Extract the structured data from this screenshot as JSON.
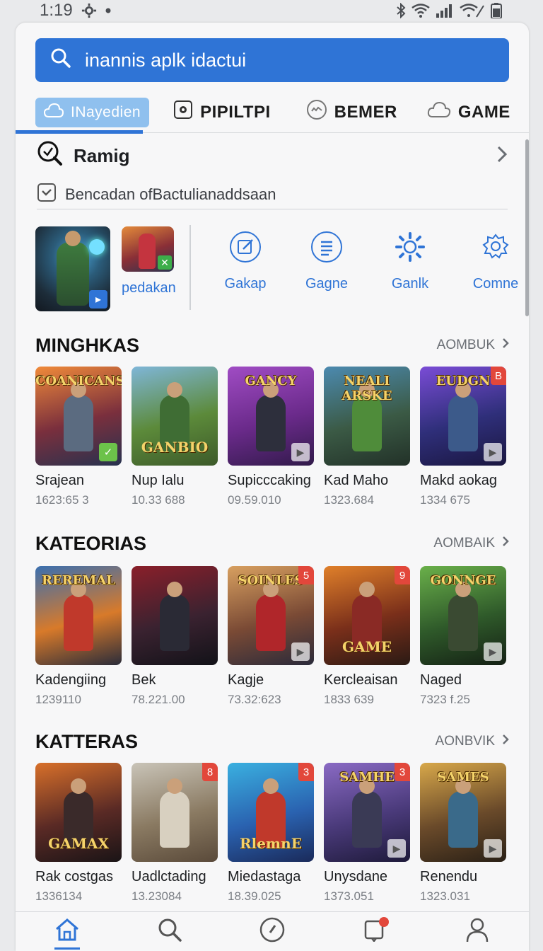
{
  "status_bar": {
    "time": "1:19"
  },
  "search": {
    "placeholder": "inannis aplk idactui"
  },
  "tabs": [
    {
      "label": "INayedien",
      "icon": "cloud-icon",
      "active": true
    },
    {
      "label": "PIPILTPI",
      "icon": "gear-box-icon"
    },
    {
      "label": "BEMER",
      "icon": "gamepad-icon"
    },
    {
      "label": "GAME",
      "icon": "cloud-outline-icon"
    }
  ],
  "ranking": {
    "title": "Ramig",
    "info_text": "Bencadan ofBactulianaddsaan"
  },
  "featured": {
    "small_label": "pedakan"
  },
  "shortcuts": [
    {
      "label": "Gakap",
      "icon": "edit-icon"
    },
    {
      "label": "Gagne",
      "icon": "list-icon"
    },
    {
      "label": "Ganlk",
      "icon": "settings-icon"
    },
    {
      "label": "Comne",
      "icon": "cog-icon"
    }
  ],
  "sections": [
    {
      "title": "MINGHKAS",
      "more": "AOMBUK",
      "items": [
        {
          "name": "Srajean",
          "meta": "1623:65 3",
          "thumb_title": "COANICANS",
          "thumb_bottom": "",
          "colors": [
            "#f08a3a",
            "#7a2f3d",
            "#27324f"
          ],
          "hero": "#5b6b80",
          "badge": "check"
        },
        {
          "name": "Nup Ialu",
          "meta": "10.33 688",
          "thumb_title": "",
          "thumb_bottom": "GANBIO",
          "colors": [
            "#7fb6d8",
            "#5c8a3a",
            "#3d5a2a"
          ],
          "hero": "#3f6d34",
          "badge": ""
        },
        {
          "name": "Supicccaking",
          "meta": "09.59.010",
          "thumb_title": "GANCY",
          "thumb_bottom": "",
          "colors": [
            "#a04cc4",
            "#6a2a8a",
            "#311a4a"
          ],
          "hero": "#2d2f3c",
          "badge": "play"
        },
        {
          "name": "Kad Maho",
          "meta": "1323.684",
          "thumb_title": "NEALI ARSKE",
          "thumb_bottom": "",
          "colors": [
            "#4c8ab0",
            "#3b5a45",
            "#223128"
          ],
          "hero": "#4f8c3a",
          "badge": ""
        },
        {
          "name": "Makd aokag",
          "meta": "1334 675",
          "thumb_title": "EUDGN",
          "thumb_bottom": "",
          "colors": [
            "#7a4cd6",
            "#2f2f7a",
            "#1a1640"
          ],
          "hero": "#3c5a8a",
          "badge": "play",
          "num": "B"
        }
      ]
    },
    {
      "title": "KATEORIAS",
      "more": "AOMBAIK",
      "items": [
        {
          "name": "Kadengiing",
          "meta": "1239110",
          "thumb_title": "REREMAL",
          "thumb_bottom": "",
          "colors": [
            "#3a6fb0",
            "#d87a2a",
            "#2a2c3a"
          ],
          "hero": "#c0392b",
          "badge": ""
        },
        {
          "name": "Bek",
          "meta": "78.221.00",
          "thumb_title": "",
          "thumb_bottom": "",
          "colors": [
            "#8a1f2a",
            "#3a2230",
            "#121218"
          ],
          "hero": "#2a2a35",
          "badge": ""
        },
        {
          "name": "Kagje",
          "meta": "73.32:623",
          "thumb_title": "SOINLES",
          "thumb_bottom": "",
          "colors": [
            "#d8a060",
            "#7a4a35",
            "#2a2a3a"
          ],
          "hero": "#b0262a",
          "badge": "play",
          "num": "5"
        },
        {
          "name": "Kercleaisan",
          "meta": "1833 639",
          "thumb_title": "",
          "thumb_bottom": "GAME",
          "colors": [
            "#e0802a",
            "#7a2f1a",
            "#2a1a14"
          ],
          "hero": "#8a2a25",
          "badge": "",
          "num": "9"
        },
        {
          "name": "Naged",
          "meta": "7323 f.25",
          "thumb_title": "GONNGE",
          "thumb_bottom": "",
          "colors": [
            "#6ab04a",
            "#2f5a2a",
            "#142014"
          ],
          "hero": "#3a4a32",
          "badge": "play"
        }
      ]
    },
    {
      "title": "KATTERAS",
      "more": "AONBVIK",
      "items": [
        {
          "name": "Rak costgas",
          "meta": "1336134",
          "thumb_title": "",
          "thumb_bottom": "GAMAX",
          "colors": [
            "#d8702a",
            "#5a2a25",
            "#1a1416"
          ],
          "hero": "#3a2a2a",
          "badge": ""
        },
        {
          "name": "Uadlctading",
          "meta": "13.23084",
          "thumb_title": "",
          "thumb_bottom": "",
          "colors": [
            "#c9c4b8",
            "#8a7a62",
            "#5a4a3a"
          ],
          "hero": "#d8d0c0",
          "badge": "",
          "num": "8"
        },
        {
          "name": "Miedastaga",
          "meta": "18.39.025",
          "thumb_title": "",
          "thumb_bottom": "RlemnE",
          "colors": [
            "#3ab0e0",
            "#2a62b0",
            "#1a2a5a"
          ],
          "hero": "#c0392b",
          "badge": "",
          "num": "3"
        },
        {
          "name": "Unysdane",
          "meta": "1373.051",
          "thumb_title": "SAMHE",
          "thumb_bottom": "",
          "colors": [
            "#8a6ac4",
            "#4a3a7a",
            "#1e1a3a"
          ],
          "hero": "#3a3a55",
          "badge": "play",
          "num": "3"
        },
        {
          "name": "Renendu",
          "meta": "1323.031",
          "thumb_title": "SAMES",
          "thumb_bottom": "",
          "colors": [
            "#d8a84a",
            "#6a4a2a",
            "#2a2016"
          ],
          "hero": "#3a6a8a",
          "badge": "play"
        }
      ]
    }
  ],
  "bottom_nav": [
    {
      "icon": "home-icon",
      "active": true
    },
    {
      "icon": "search-icon"
    },
    {
      "icon": "compass-icon"
    },
    {
      "icon": "notification-icon",
      "dot": true
    },
    {
      "icon": "profile-icon"
    }
  ],
  "colors": {
    "accent": "#2f74d6",
    "active_tab_bg": "#8fc0ee",
    "badge_red": "#e2473b"
  }
}
